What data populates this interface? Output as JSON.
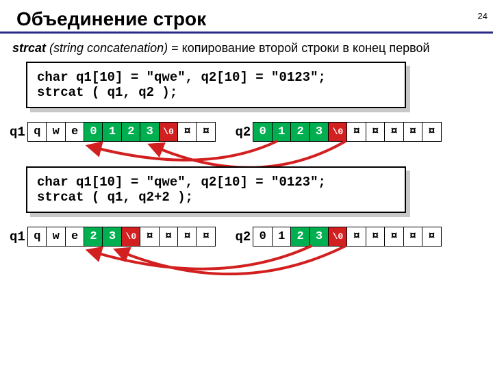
{
  "page_number": "24",
  "title": "Объединение строк",
  "lead_fn": "strcat",
  "lead_paren": "(string concatenation)",
  "lead_rest": " = копирование второй строки в конец первой",
  "code1_line1": "char q1[10] = \"qwe\", q2[10] = \"0123\";",
  "code1_line2": "strcat ( q1, q2 );",
  "code2_line1": "char q1[10] = \"qwe\", q2[10] = \"0123\";",
  "code2_line2": "strcat ( q1, q2+2 );",
  "labels": {
    "q1": "q1",
    "q2": "q2"
  },
  "row1_q1": [
    "q",
    "w",
    "e",
    "0",
    "1",
    "2",
    "3",
    "\\0",
    "¤",
    "¤"
  ],
  "row1_q1_cls": [
    "w",
    "w",
    "w",
    "g",
    "g",
    "g",
    "g",
    "r",
    "w",
    "w"
  ],
  "row1_q2": [
    "0",
    "1",
    "2",
    "3",
    "\\0",
    "¤",
    "¤",
    "¤",
    "¤",
    "¤"
  ],
  "row1_q2_cls": [
    "g",
    "g",
    "g",
    "g",
    "r",
    "w",
    "w",
    "w",
    "w",
    "w"
  ],
  "row2_q1": [
    "q",
    "w",
    "e",
    "2",
    "3",
    "\\0",
    "¤",
    "¤",
    "¤",
    "¤"
  ],
  "row2_q1_cls": [
    "w",
    "w",
    "w",
    "g",
    "g",
    "r",
    "w",
    "w",
    "w",
    "w"
  ],
  "row2_q2": [
    "0",
    "1",
    "2",
    "3",
    "\\0",
    "¤",
    "¤",
    "¤",
    "¤",
    "¤"
  ],
  "row2_q2_cls": [
    "w",
    "w",
    "g",
    "g",
    "r",
    "w",
    "w",
    "w",
    "w",
    "w"
  ]
}
